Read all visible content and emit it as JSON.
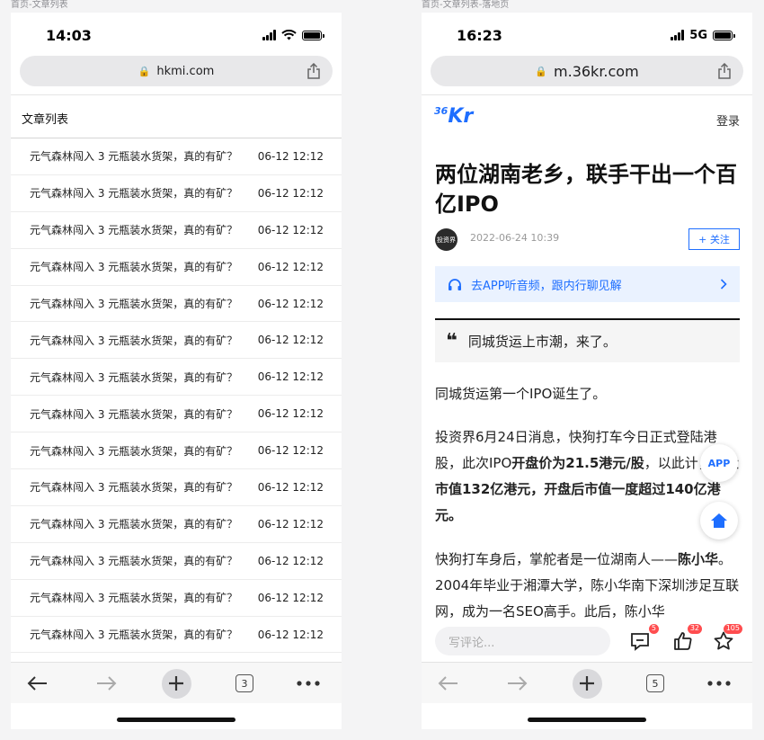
{
  "left": {
    "caption": "首页-文章列表",
    "status": {
      "time": "14:03"
    },
    "url": "hkmi.com",
    "list_title": "文章列表",
    "articles": [
      {
        "title": "元气森林闯入 3 元瓶装水货架，真的有矿？",
        "date": "06-12 12:12"
      },
      {
        "title": "元气森林闯入 3 元瓶装水货架，真的有矿？",
        "date": "06-12 12:12"
      },
      {
        "title": "元气森林闯入 3 元瓶装水货架，真的有矿？",
        "date": "06-12 12:12"
      },
      {
        "title": "元气森林闯入 3 元瓶装水货架，真的有矿？",
        "date": "06-12 12:12"
      },
      {
        "title": "元气森林闯入 3 元瓶装水货架，真的有矿？",
        "date": "06-12 12:12"
      },
      {
        "title": "元气森林闯入 3 元瓶装水货架，真的有矿？",
        "date": "06-12 12:12"
      },
      {
        "title": "元气森林闯入 3 元瓶装水货架，真的有矿？",
        "date": "06-12 12:12"
      },
      {
        "title": "元气森林闯入 3 元瓶装水货架，真的有矿？",
        "date": "06-12 12:12"
      },
      {
        "title": "元气森林闯入 3 元瓶装水货架，真的有矿？",
        "date": "06-12 12:12"
      },
      {
        "title": "元气森林闯入 3 元瓶装水货架，真的有矿？",
        "date": "06-12 12:12"
      },
      {
        "title": "元气森林闯入 3 元瓶装水货架，真的有矿？",
        "date": "06-12 12:12"
      },
      {
        "title": "元气森林闯入 3 元瓶装水货架，真的有矿？",
        "date": "06-12 12:12"
      },
      {
        "title": "元气森林闯入 3 元瓶装水货架，真的有矿？",
        "date": "06-12 12:12"
      },
      {
        "title": "元气森林闯入 3 元瓶装水货架，真的有矿？",
        "date": "06-12 12:12"
      }
    ],
    "toolbar": {
      "tab_count": "3"
    }
  },
  "right": {
    "caption": "首页-文章列表-落地页",
    "status": {
      "time": "16:23",
      "network": "5G"
    },
    "url": "m.36kr.com",
    "logo": {
      "number": "36",
      "letters": "Kr"
    },
    "login": "登录",
    "article": {
      "title": "两位湖南老乡，联手干出一个百亿IPO",
      "author_avatar_text": "投资界",
      "published": "2022-06-24 10:39",
      "follow": "+ 关注",
      "audio_prompt": "去APP听音频，跟内行聊见解",
      "quote_mark": "❝",
      "quote": "同城货运上市潮，来了。",
      "para1": "同城货运第一个IPO诞生了。",
      "para2": {
        "t1": "投资界6月24日消息，快狗打车今日正式登陆港股，此次IPO",
        "b1": "开盘价为21.5港元/股",
        "t2": "，以此计，",
        "b2": "开盘市值132亿港元，开盘后市值一度超过140亿港元。"
      },
      "para3": {
        "t1": "快狗打车身后，掌舵者是一位湖南人——",
        "b1": "陈小华",
        "t2": "。2004年毕业于湘潭大学，陈小华南下深圳涉足互联网，成为一名SEO高手。此后，陈小华"
      }
    },
    "fab_app": "APP",
    "comment_placeholder": "写评论...",
    "counts": {
      "comments": "5",
      "likes": "32",
      "favorites": "105"
    },
    "toolbar": {
      "tab_count": "5"
    }
  },
  "colors": {
    "accent": "#1e6eff",
    "badge": "#ff4d4f"
  }
}
